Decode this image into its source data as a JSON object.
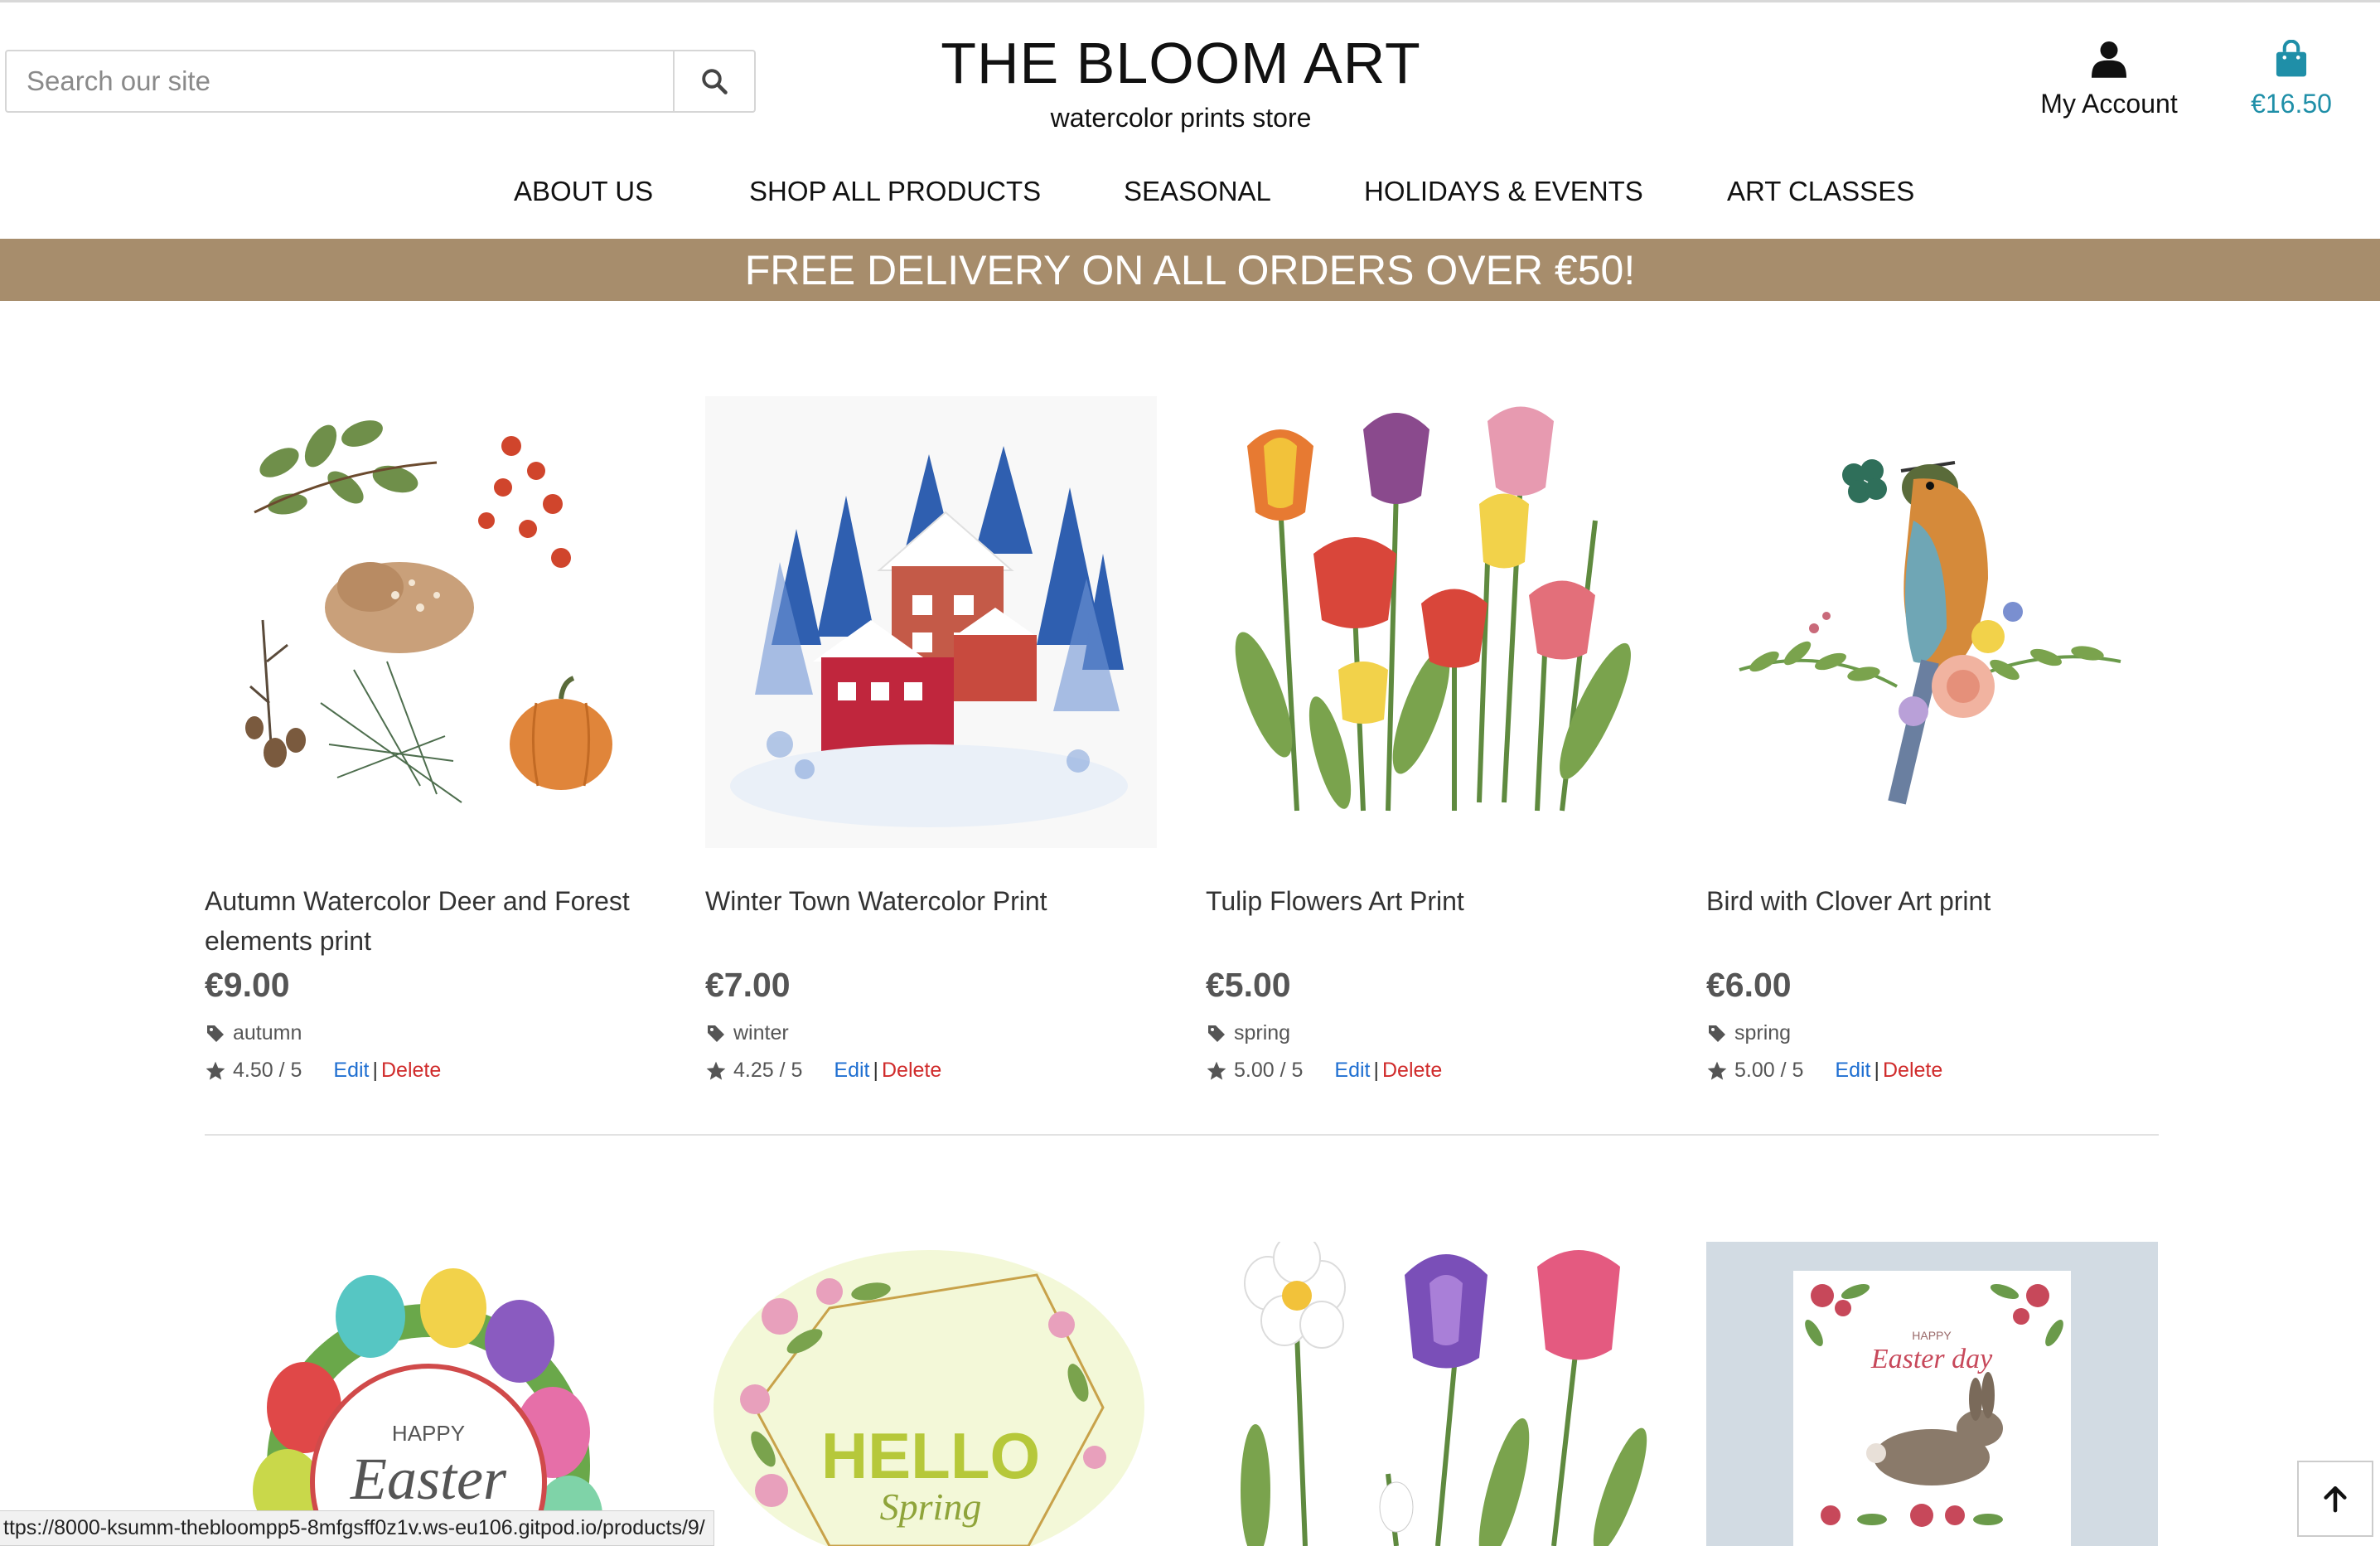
{
  "header": {
    "search_placeholder": "Search our site",
    "brand_title": "THE BLOOM ART",
    "brand_subtitle": "watercolor prints store",
    "account_label": "My Account",
    "cart_total": "€16.50"
  },
  "nav": [
    "ABOUT US",
    "SHOP ALL PRODUCTS",
    "SEASONAL",
    "HOLIDAYS & EVENTS",
    "ART CLASSES"
  ],
  "banner": "FREE DELIVERY ON ALL ORDERS OVER €50!",
  "products": [
    {
      "name": "Autumn Watercolor Deer and Forest elements print",
      "price": "€9.00",
      "category": "autumn",
      "rating": "4.50 / 5",
      "edit": "Edit",
      "delete": "Delete"
    },
    {
      "name": "Winter Town Watercolor Print",
      "price": "€7.00",
      "category": "winter",
      "rating": "4.25 / 5",
      "edit": "Edit",
      "delete": "Delete"
    },
    {
      "name": "Tulip Flowers Art Print",
      "price": "€5.00",
      "category": "spring",
      "rating": "5.00 / 5",
      "edit": "Edit",
      "delete": "Delete"
    },
    {
      "name": "Bird with Clover Art print",
      "price": "€6.00",
      "category": "spring",
      "rating": "5.00 / 5",
      "edit": "Edit",
      "delete": "Delete"
    }
  ],
  "row2_images": {
    "easter_happy": "HAPPY",
    "easter_word": "Easter",
    "hello": "HELLO",
    "spring": "Spring",
    "card_happy": "HAPPY",
    "card_easter_day": "Easter day"
  },
  "status_url": "ttps://8000-ksumm-thebloompp5-8mfgsff0z1v.ws-eu106.gitpod.io/products/9/",
  "colors": {
    "banner": "#a78d6c",
    "cart": "#1f8fa8",
    "edit": "#1f6fd1",
    "delete": "#d02b2b"
  }
}
